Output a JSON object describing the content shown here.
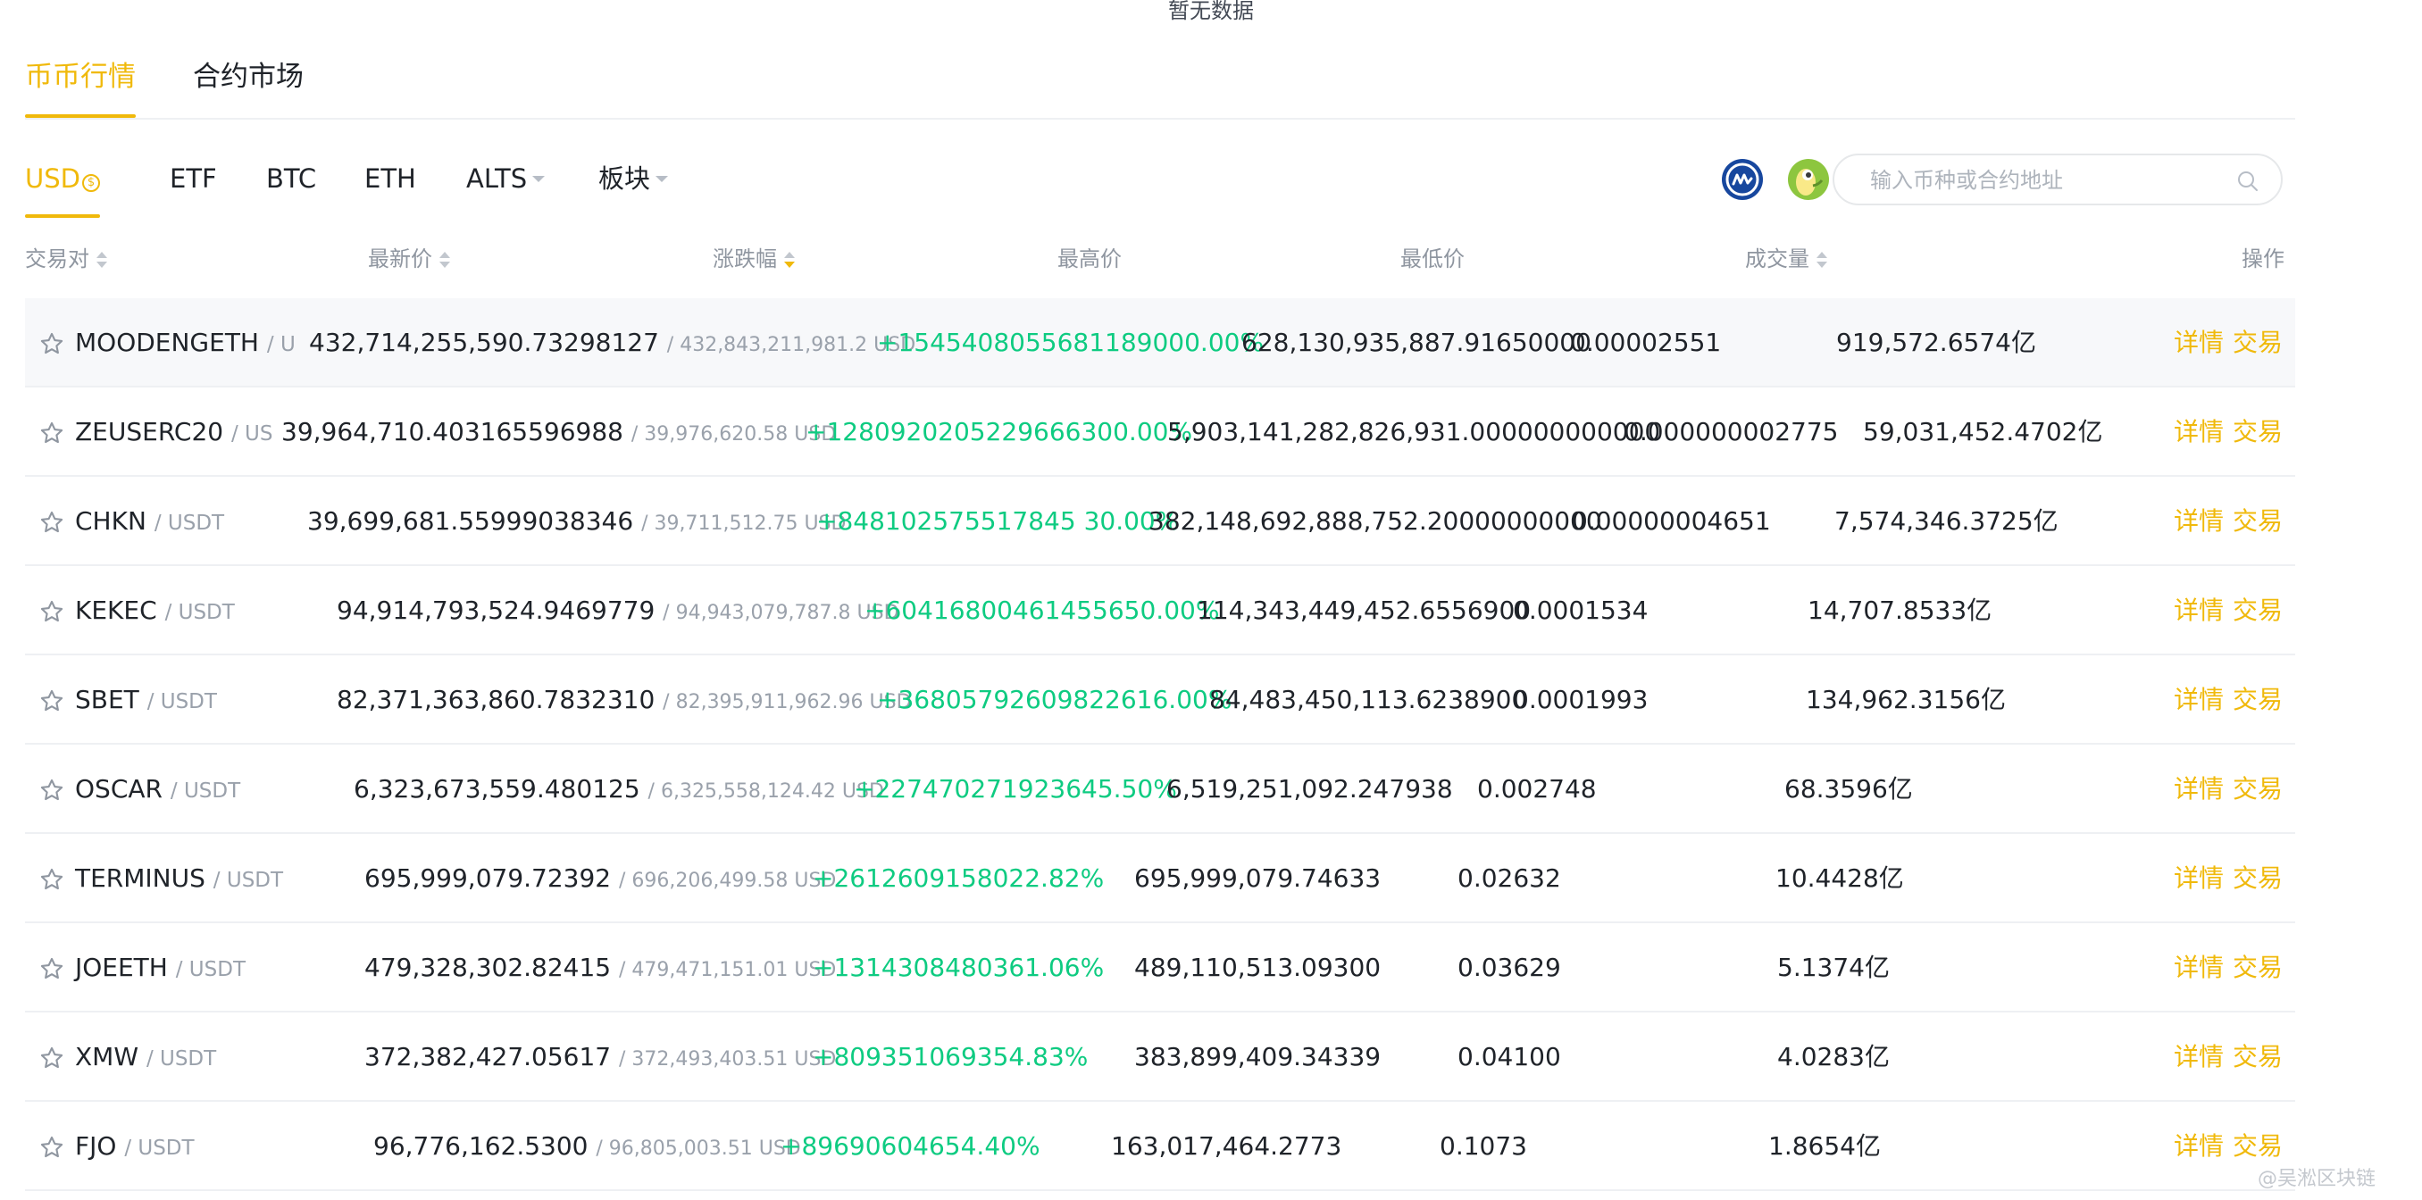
{
  "top_note": "暂无数据",
  "main_tabs": [
    {
      "label": "币币行情",
      "active": true
    },
    {
      "label": "合约市场",
      "active": false
    }
  ],
  "sub_tabs": [
    {
      "label": "USD",
      "active": true
    },
    {
      "label": "ETF"
    },
    {
      "label": "BTC"
    },
    {
      "label": "ETH"
    },
    {
      "label": "ALTS",
      "dropdown": true
    },
    {
      "label": "板块",
      "dropdown": true
    }
  ],
  "search": {
    "placeholder": "输入币种或合约地址"
  },
  "columns": [
    "交易对",
    "最新价",
    "涨跌幅",
    "最高价",
    "最低价",
    "成交量",
    "操作"
  ],
  "actions": {
    "detail": "详情",
    "trade": "交易"
  },
  "colors": {
    "accent": "#f0b90b",
    "up": "#0ecb81"
  },
  "rows": [
    {
      "base": "MOODENGETH",
      "quote": "/ U",
      "price": "432,714,255,590.73298127",
      "ref": "/ 432,843,211,981.2 USD",
      "change": "+1545408055681189000.00%",
      "high": "628,130,935,887.91650000",
      "low": "0.00002551",
      "volume": "919,572.6574亿"
    },
    {
      "base": "ZEUSERC20",
      "quote": "/ US",
      "price": "39,964,710.403165596988",
      "ref": "/ 39,976,620.58 USD",
      "change": "+1280920205229666300.00%",
      "high": "5,903,141,282,826,931.000000000000",
      "low": "0.000000002775",
      "volume": "59,031,452.4702亿"
    },
    {
      "base": "CHKN",
      "quote": "/ USDT",
      "price": "39,699,681.55999038346",
      "ref": "/ 39,711,512.75 USD",
      "change": "+848102575517845 30.00%",
      "high": "382,148,692,888,752.20000000000",
      "low": "0.00000004651",
      "volume": "7,574,346.3725亿"
    },
    {
      "base": "KEKEC",
      "quote": "/ USDT",
      "price": "94,914,793,524.9469779",
      "ref": "/ 94,943,079,787.8 USD",
      "change": "+60416800461455650.00%",
      "high": "114,343,449,452.6556900",
      "low": "0.0001534",
      "volume": "14,707.8533亿"
    },
    {
      "base": "SBET",
      "quote": "/ USDT",
      "price": "82,371,363,860.7832310",
      "ref": "/ 82,395,911,962.96 USD",
      "change": "+36805792609822616.00%",
      "high": "84,483,450,113.6238900",
      "low": "0.0001993",
      "volume": "134,962.3156亿"
    },
    {
      "base": "OSCAR",
      "quote": "/ USDT",
      "price": "6,323,673,559.480125",
      "ref": "/ 6,325,558,124.42 USD",
      "change": "+227470271923645.50%",
      "high": "6,519,251,092.247938",
      "low": "0.002748",
      "volume": "68.3596亿"
    },
    {
      "base": "TERMINUS",
      "quote": "/ USDT",
      "price": "695,999,079.72392",
      "ref": "/ 696,206,499.58 USD",
      "change": "+2612609158022.82%",
      "high": "695,999,079.74633",
      "low": "0.02632",
      "volume": "10.4428亿"
    },
    {
      "base": "JOEETH",
      "quote": "/ USDT",
      "price": "479,328,302.82415",
      "ref": "/ 479,471,151.01 USD",
      "change": "+1314308480361.06%",
      "high": "489,110,513.09300",
      "low": "0.03629",
      "volume": "5.1374亿"
    },
    {
      "base": "XMW",
      "quote": "/ USDT",
      "price": "372,382,427.05617",
      "ref": "/ 372,493,403.51 USD",
      "change": "+809351069354.83%",
      "high": "383,899,409.34339",
      "low": "0.04100",
      "volume": "4.0283亿"
    },
    {
      "base": "FJO",
      "quote": "/ USDT",
      "price": "96,776,162.5300",
      "ref": "/ 96,805,003.51 USD",
      "change": "+89690604654.40%",
      "high": "163,017,464.2773",
      "low": "0.1073",
      "volume": "1.8654亿"
    }
  ],
  "watermark": "@吴淞区块链"
}
